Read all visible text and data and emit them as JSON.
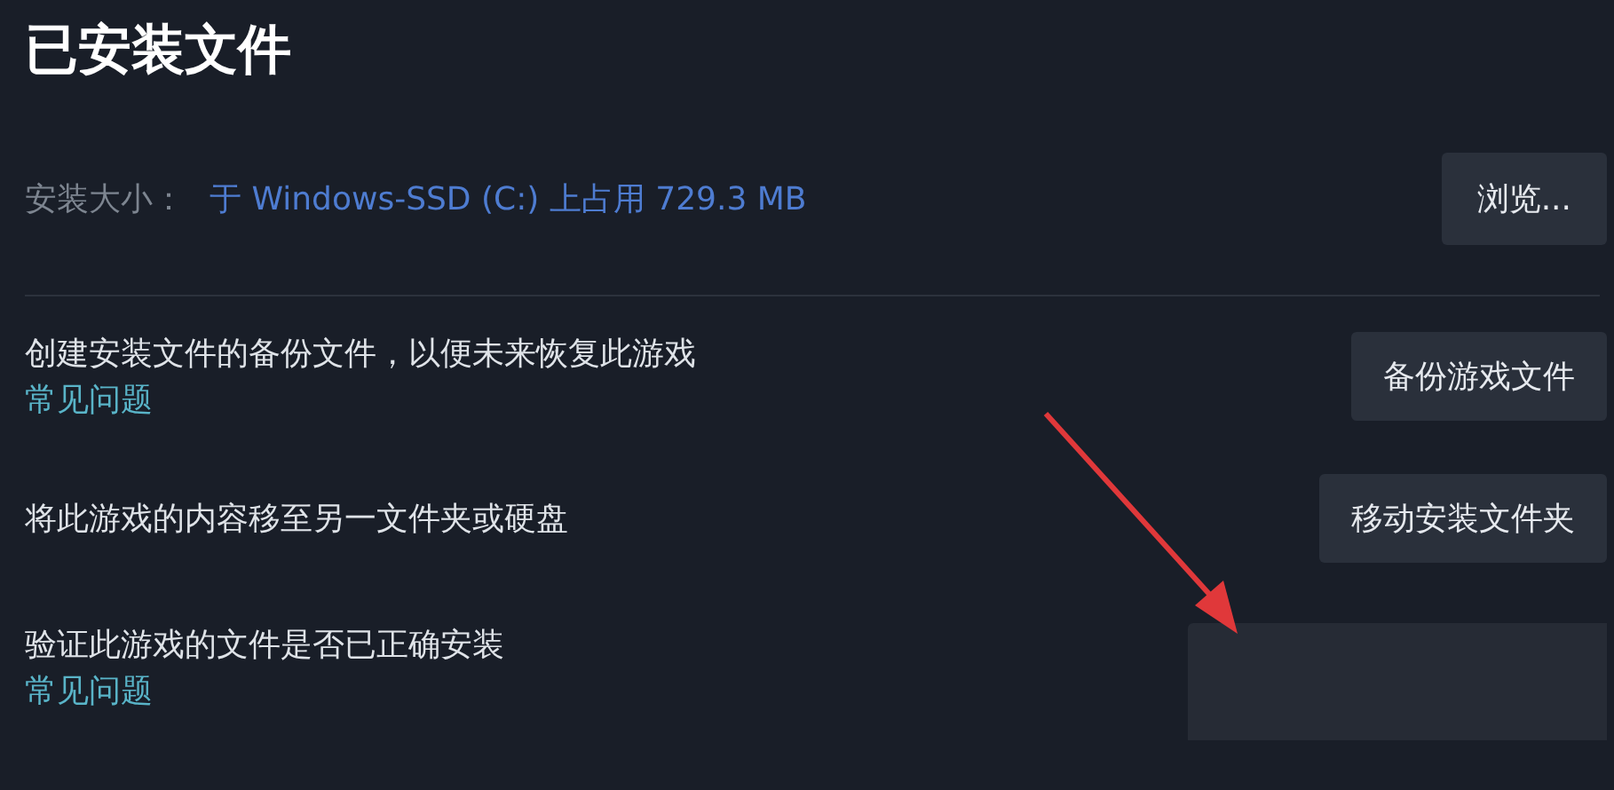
{
  "title": "已安装文件",
  "install_size": {
    "label": "安装大小：",
    "value": "于 Windows-SSD (C:) 上占用 729.3 MB",
    "button": "浏览..."
  },
  "actions": [
    {
      "description": "创建安装文件的备份文件，以便未来恢复此游戏",
      "link": "常见问题",
      "button": "备份游戏文件"
    },
    {
      "description": "将此游戏的内容移至另一文件夹或硬盘",
      "button": "移动安装文件夹"
    },
    {
      "description": "验证此游戏的文件是否已正确安装",
      "link": "常见问题"
    }
  ]
}
